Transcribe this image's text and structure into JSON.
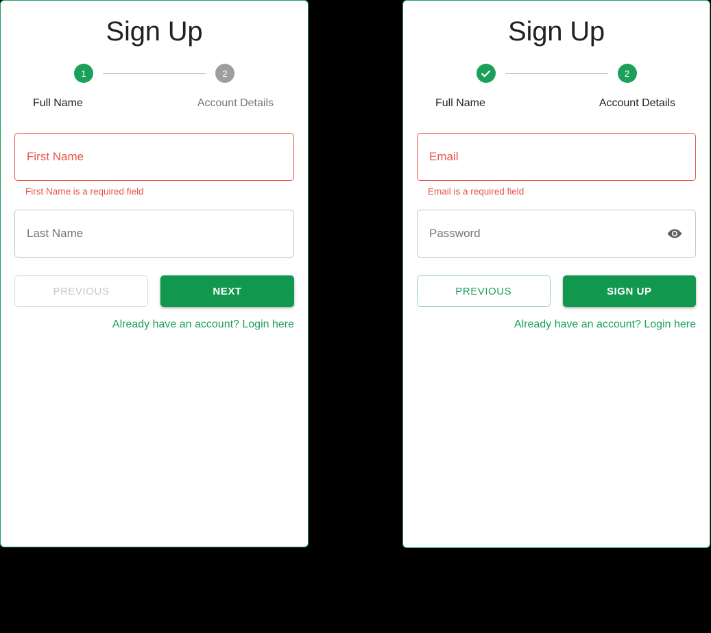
{
  "theme": {
    "green": "#1aa05a",
    "green_button": "#12974f",
    "error_red": "#e8544b",
    "grey_step": "#9e9e9e",
    "background": "#000000",
    "card_background": "#ffffff"
  },
  "cards": [
    {
      "id": "signup-step-1",
      "title": "Sign Up",
      "stepper": {
        "steps": [
          {
            "marker": "1",
            "state": "active",
            "label": "Full Name"
          },
          {
            "marker": "2",
            "state": "inactive",
            "label": "Account Details"
          }
        ]
      },
      "fields": [
        {
          "name": "first-name",
          "placeholder": "First Name",
          "value": "",
          "state": "error",
          "error": "First Name is a required field",
          "has_toggle": false
        },
        {
          "name": "last-name",
          "placeholder": "Last Name",
          "value": "",
          "state": "normal",
          "error": "",
          "has_toggle": false
        }
      ],
      "buttons": {
        "previous_label": "PREVIOUS",
        "previous_state": "disabled",
        "primary_label": "NEXT"
      },
      "login_link": "Already have an account? Login here"
    },
    {
      "id": "signup-step-2",
      "title": "Sign Up",
      "stepper": {
        "steps": [
          {
            "marker": "check",
            "state": "done",
            "label": "Full Name"
          },
          {
            "marker": "2",
            "state": "active",
            "label": "Account Details"
          }
        ]
      },
      "fields": [
        {
          "name": "email",
          "placeholder": "Email",
          "value": "",
          "state": "error",
          "error": "Email is a required field",
          "has_toggle": false
        },
        {
          "name": "password",
          "placeholder": "Password",
          "value": "",
          "state": "normal",
          "error": "",
          "has_toggle": true,
          "toggle_icon": "eye-icon"
        }
      ],
      "buttons": {
        "previous_label": "PREVIOUS",
        "previous_state": "enabled",
        "primary_label": "SIGN UP"
      },
      "login_link": "Already have an account? Login here"
    }
  ]
}
